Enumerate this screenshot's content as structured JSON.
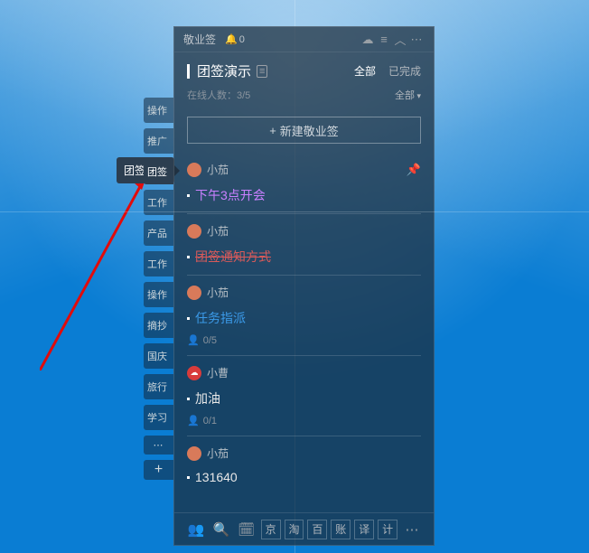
{
  "app": {
    "name": "敬业签",
    "notif_count": "0"
  },
  "page": {
    "title": "团签演示",
    "filter_all": "全部",
    "filter_done": "已完成",
    "online_label": "在线人数：",
    "online_count": "3/5",
    "sub_filter": "全部",
    "new_button": "新建敬业签"
  },
  "side_tabs": [
    "操作",
    "推广",
    "团签",
    "工作",
    "产品",
    "工作",
    "操作",
    "摘抄",
    "国庆",
    "旅行",
    "学习"
  ],
  "tooltip": "团签演示",
  "items": [
    {
      "author": "小茄",
      "text": "下午3点开会",
      "style": "purple",
      "pinned": true
    },
    {
      "author": "小茄",
      "text": "团签通知方式",
      "style": "strike"
    },
    {
      "author": "小茄",
      "text": "任务指派",
      "style": "blue",
      "meta": "0/5"
    },
    {
      "author": "小曹",
      "avatar": "red",
      "avatar_glyph": "☁",
      "text": "加油",
      "style": "plain",
      "meta": "0/1"
    },
    {
      "author": "小茄",
      "text": "131640",
      "style": "plain"
    }
  ],
  "bottom_tabs": [
    "京",
    "淘",
    "百",
    "账",
    "译",
    "计"
  ]
}
